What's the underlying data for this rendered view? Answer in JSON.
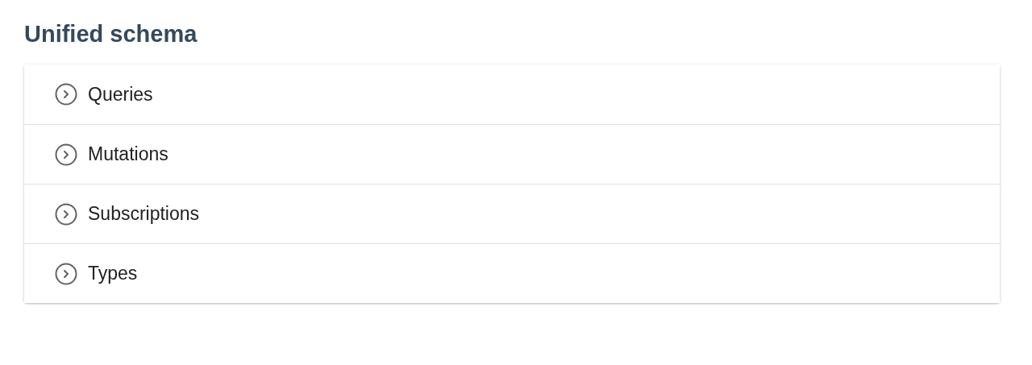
{
  "title": "Unified schema",
  "sections": [
    {
      "label": "Queries",
      "expanded": false
    },
    {
      "label": "Mutations",
      "expanded": false
    },
    {
      "label": "Subscriptions",
      "expanded": false
    },
    {
      "label": "Types",
      "expanded": false
    }
  ]
}
